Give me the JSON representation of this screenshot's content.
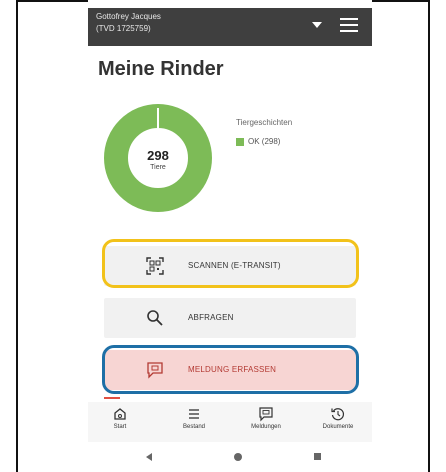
{
  "header": {
    "user_name": "Gottofrey Jacques",
    "user_id": "(TVD 1725759)"
  },
  "page_title": "Meine Rinder",
  "summary": {
    "total": "298",
    "total_label": "Tiere",
    "legend_title": "Tiergeschichten",
    "legend_ok": "OK (298)"
  },
  "chart_data": {
    "type": "pie",
    "categories": [
      "OK"
    ],
    "values": [
      298
    ],
    "colors": [
      "#7dbb57"
    ]
  },
  "actions": {
    "scan": "SCANNEN (E-TRANSIT)",
    "query": "ABFRAGEN",
    "report": "MELDUNG ERFASSEN"
  },
  "nav": {
    "start": "Start",
    "bestand": "Bestand",
    "meldungen": "Meldungen",
    "dokumente": "Dokumente"
  },
  "colors": {
    "accent_green": "#7dbb57",
    "highlight_yellow": "#f2c21a",
    "highlight_blue": "#1e6fa6",
    "report_bg": "#f7d5d3"
  }
}
